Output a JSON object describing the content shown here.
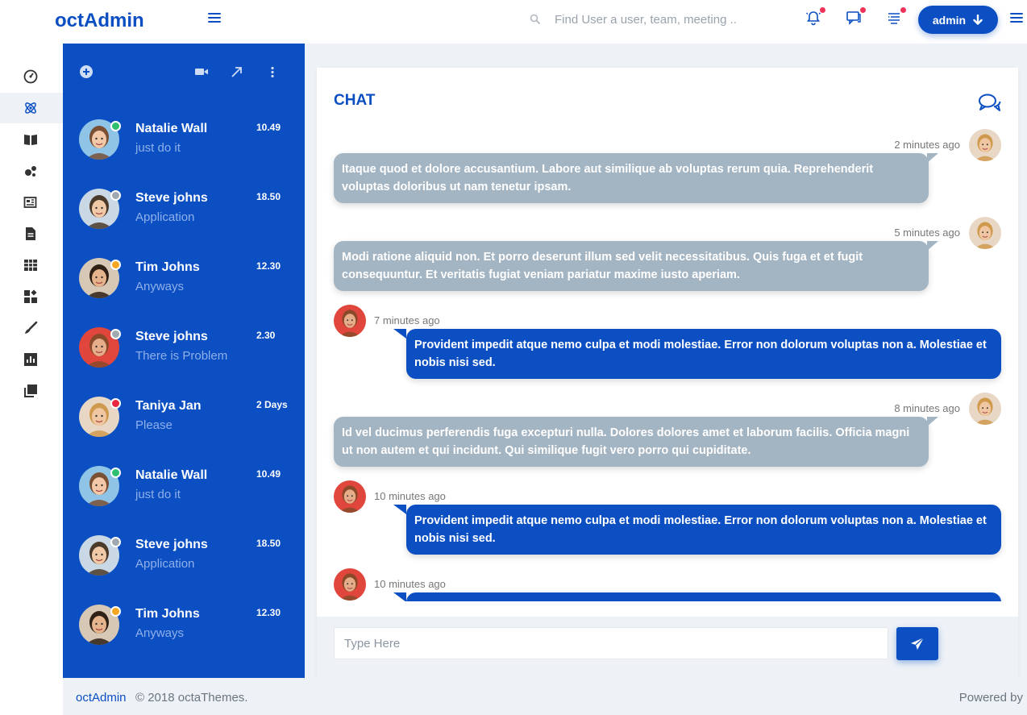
{
  "app": {
    "brand": "octAdmin"
  },
  "header": {
    "search_placeholder": "Find User a user, team, meeting ..",
    "admin_label": "admin"
  },
  "contacts": [
    {
      "name": "Natalie Wall",
      "message": "just do it",
      "time": "10.49",
      "status": "online",
      "status_color": "#2fbf71"
    },
    {
      "name": "Steve johns",
      "message": "Application",
      "time": "18.50",
      "status": "offline",
      "status_color": "#a0a8b0"
    },
    {
      "name": "Tim Johns",
      "message": "Anyways",
      "time": "12.30",
      "status": "away",
      "status_color": "#f5a623"
    },
    {
      "name": "Steve johns",
      "message": "There is Problem",
      "time": "2.30",
      "status": "offline",
      "status_color": "#a0a8b0"
    },
    {
      "name": "Taniya Jan",
      "message": "Please",
      "time": "2 Days",
      "status": "busy",
      "status_color": "#e8273f"
    },
    {
      "name": "Natalie Wall",
      "message": "just do it",
      "time": "10.49",
      "status": "online",
      "status_color": "#2fbf71"
    },
    {
      "name": "Steve johns",
      "message": "Application",
      "time": "18.50",
      "status": "offline",
      "status_color": "#a0a8b0"
    },
    {
      "name": "Tim Johns",
      "message": "Anyways",
      "time": "12.30",
      "status": "away",
      "status_color": "#f5a623"
    }
  ],
  "chat": {
    "title": "CHAT",
    "messages": [
      {
        "side": "left",
        "time": "2 minutes ago",
        "text": "Itaque quod et dolore accusantium. Labore aut similique ab voluptas rerum quia. Reprehenderit voluptas doloribus ut nam tenetur ipsam."
      },
      {
        "side": "left",
        "time": "5 minutes ago",
        "text": "Modi ratione aliquid non. Et porro deserunt illum sed velit necessitatibus. Quis fuga et et fugit consequuntur. Et veritatis fugiat veniam pariatur maxime iusto aperiam."
      },
      {
        "side": "right",
        "time": "7 minutes ago",
        "text": "Provident impedit atque nemo culpa et modi molestiae. Error non dolorum voluptas non a. Molestiae et nobis nisi sed."
      },
      {
        "side": "left",
        "time": "8 minutes ago",
        "text": "Id vel ducimus perferendis fuga excepturi nulla. Dolores dolores amet et laborum facilis. Officia magni ut non autem et qui incidunt. Qui similique fugit vero porro qui cupiditate."
      },
      {
        "side": "right",
        "time": "10 minutes ago",
        "text": "Provident impedit atque nemo culpa et modi molestiae. Error non dolorum voluptas non a. Molestiae et nobis nisi sed."
      },
      {
        "side": "right",
        "time": "10 minutes ago",
        "text": ""
      }
    ],
    "input_placeholder": "Type Here"
  },
  "footer": {
    "brand_link": "octAdmin",
    "copyright": "© 2018 octaThemes.",
    "powered": "Powered by"
  },
  "colors": {
    "primary": "#0b4fc2",
    "bubble_gray": "#a3b4c2",
    "notification_dot": "#f0335a"
  }
}
